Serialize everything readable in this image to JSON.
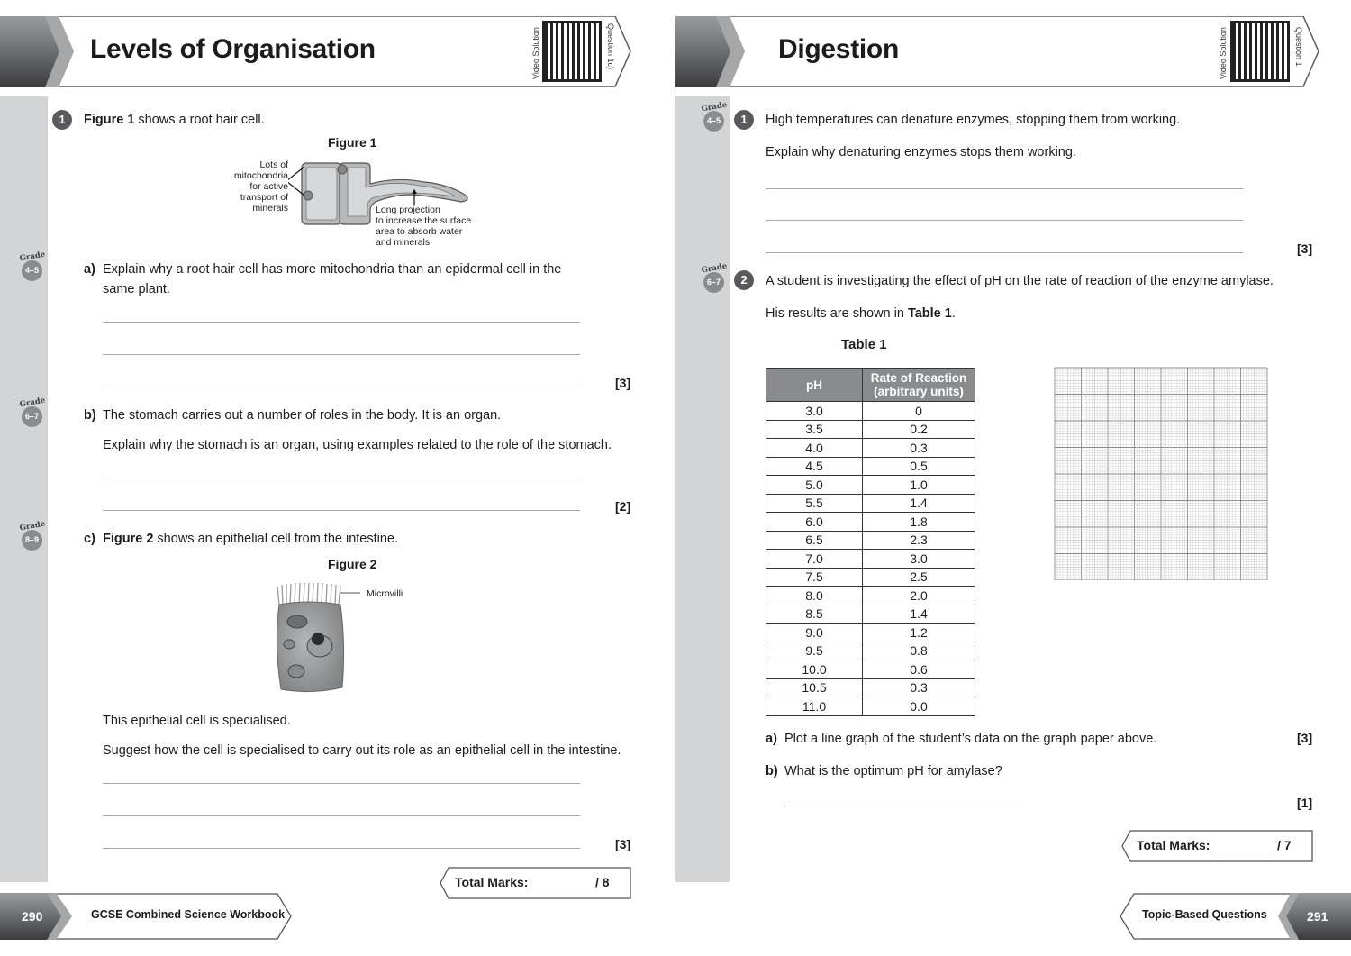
{
  "left_page": {
    "header": {
      "title": "Levels of Organisation",
      "video_label": "Video Solution",
      "question_ref": "Question 1c)"
    },
    "question1": {
      "number": "1",
      "intro_bold": "Figure 1",
      "intro_rest": " shows a root hair cell.",
      "figure1": {
        "title": "Figure 1",
        "label_mitochondria": [
          "Lots of",
          "mitochondria",
          "for active",
          "transport of",
          "minerals"
        ],
        "label_projection": [
          "Long projection",
          "to increase the surface",
          "area to absorb water",
          "and minerals"
        ]
      },
      "part_a": {
        "grade": "4–5",
        "letter": "a)",
        "text_line1": "Explain why a root hair cell has more mitochondria than an epidermal cell in the",
        "text_line2": "same plant.",
        "marks": "[3]"
      },
      "part_b": {
        "grade": "6–7",
        "letter": "b)",
        "text": "The stomach carries out a number of roles in the body. It is an organ.",
        "prompt": "Explain why the stomach is an organ, using examples related to the role of the stomach.",
        "marks": "[2]"
      },
      "part_c": {
        "grade": "8–9",
        "letter": "c)",
        "text_bold": "Figure 2",
        "text_rest": " shows an epithelial cell from the intestine.",
        "figure2": {
          "title": "Figure 2",
          "label": "Microvilli"
        },
        "statement": "This epithelial cell is specialised.",
        "prompt": "Suggest how the cell is specialised to carry out its role as an epithelial cell in the intestine.",
        "marks": "[3]"
      }
    },
    "total": {
      "label": "Total Marks:",
      "max": "/ 8"
    },
    "footer": {
      "page_number": "290",
      "title": "GCSE Combined Science Workbook"
    }
  },
  "grade_word": "Grade",
  "right_page": {
    "header": {
      "title": "Digestion",
      "video_label": "Video Solution",
      "question_ref": "Question 1"
    },
    "question1": {
      "grade": "4–5",
      "number": "1",
      "text": "High temperatures can denature enzymes, stopping them from working.",
      "prompt": "Explain why denaturing enzymes stops them working.",
      "marks": "[3]"
    },
    "question2": {
      "grade": "6–7",
      "number": "2",
      "text": "A student is investigating the effect of pH on the rate of reaction of the enzyme amylase.",
      "results_pre": "His results are shown in ",
      "results_bold": "Table 1",
      "results_post": ".",
      "table_title": "Table 1",
      "table": {
        "headers": [
          "pH",
          "Rate of Reaction",
          "(arbitrary units)"
        ],
        "rows": [
          [
            "3.0",
            "0"
          ],
          [
            "3.5",
            "0.2"
          ],
          [
            "4.0",
            "0.3"
          ],
          [
            "4.5",
            "0.5"
          ],
          [
            "5.0",
            "1.0"
          ],
          [
            "5.5",
            "1.4"
          ],
          [
            "6.0",
            "1.8"
          ],
          [
            "6.5",
            "2.3"
          ],
          [
            "7.0",
            "3.0"
          ],
          [
            "7.5",
            "2.5"
          ],
          [
            "8.0",
            "2.0"
          ],
          [
            "8.5",
            "1.4"
          ],
          [
            "9.0",
            "1.2"
          ],
          [
            "9.5",
            "0.8"
          ],
          [
            "10.0",
            "0.6"
          ],
          [
            "10.5",
            "0.3"
          ],
          [
            "11.0",
            "0.0"
          ]
        ]
      },
      "part_a": {
        "letter": "a)",
        "text": "Plot a line graph of the student’s data on the graph paper above.",
        "marks": "[3]"
      },
      "part_b": {
        "letter": "b)",
        "text": "What is the optimum pH for amylase?",
        "marks": "[1]"
      }
    },
    "total": {
      "label": "Total Marks:",
      "max": "/ 7"
    },
    "footer": {
      "page_number": "291",
      "title": "Topic-Based Questions"
    }
  },
  "colors": {
    "strip": "#d3d4d6",
    "badge": "#5a5a5c",
    "grade_circle": "#8a8b8d",
    "table_header": "#8a8b8d",
    "banner_dark": "#4a4a4c"
  }
}
